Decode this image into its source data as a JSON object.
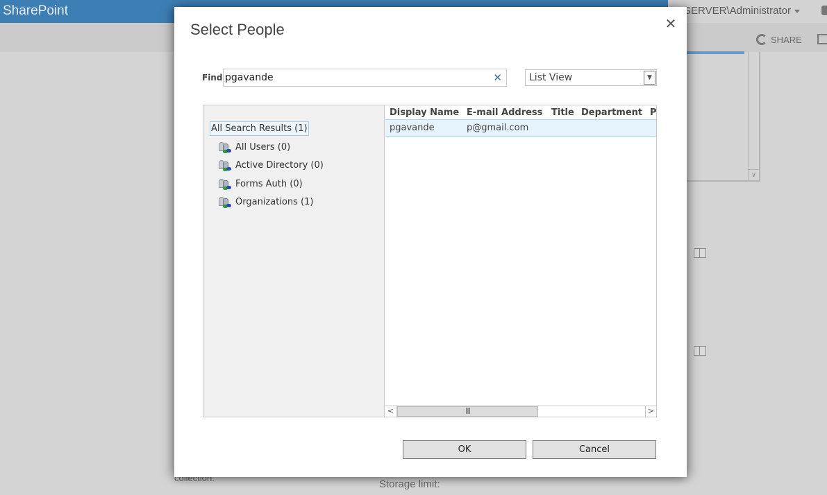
{
  "background": {
    "brand": "SharePoint",
    "user_menu": "SERVER\\Administrator",
    "share_label": "SHARE",
    "text_collection": "collection.",
    "text_storage": "Storage limit:"
  },
  "dialog": {
    "title": "Select People",
    "find_label": "Find",
    "find_value": "pgavande",
    "view_select": "List View",
    "tree": {
      "root": "All Search Results (1)",
      "items": [
        {
          "label": "All Users (0)"
        },
        {
          "label": "Active Directory (0)"
        },
        {
          "label": "Forms Auth (0)"
        },
        {
          "label": "Organizations (1)"
        }
      ]
    },
    "grid": {
      "columns": [
        "Display Name",
        "E-mail Address",
        "Title",
        "Department",
        "P"
      ],
      "rows": [
        {
          "display_name": "pgavande",
          "email": "p@gmail.com",
          "title": "",
          "department": ""
        }
      ]
    },
    "ok_label": "OK",
    "cancel_label": "Cancel"
  },
  "colors": {
    "suitebar": "#3d7fb5",
    "row_selected": "#e5f3fd",
    "clear_icon": "#3d6ea8"
  }
}
